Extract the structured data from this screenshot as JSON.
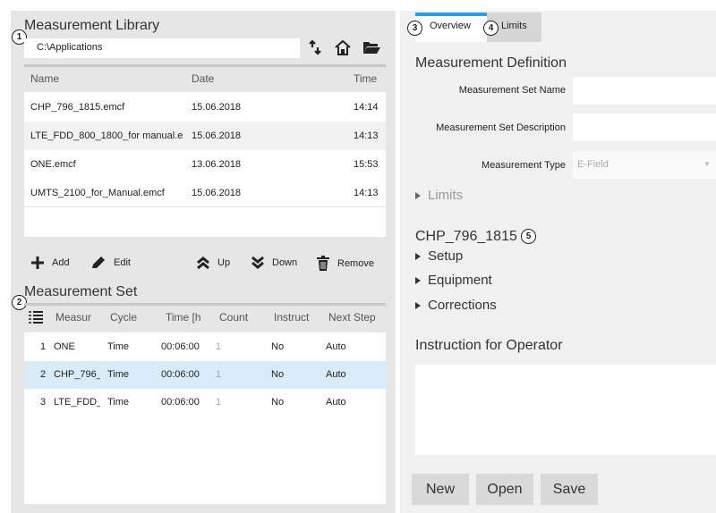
{
  "library": {
    "title": "Measurement Library",
    "path": "C:\\Applications",
    "callout": "1",
    "icons": [
      "refresh-icon",
      "home-icon",
      "folder-open-icon"
    ],
    "columns": [
      "Name",
      "Date",
      "Time"
    ],
    "rows": [
      {
        "name": "CHP_796_1815.emcf",
        "date": "15.06.2018",
        "time": "14:14"
      },
      {
        "name": "LTE_FDD_800_1800_for manual.e",
        "date": "15.06.2018",
        "time": "14:13"
      },
      {
        "name": "ONE.emcf",
        "date": "13.06.2018",
        "time": "15:53"
      },
      {
        "name": "UMTS_2100_for_Manual.emcf",
        "date": "15.06.2018",
        "time": "14:13"
      }
    ]
  },
  "toolbar": {
    "add": "Add",
    "edit": "Edit",
    "up": "Up",
    "down": "Down",
    "remove": "Remove"
  },
  "set": {
    "title": "Measurement Set",
    "callout": "2",
    "columns": [
      "Measur",
      "Cycle",
      "Time [h",
      "Count",
      "Instruct",
      "Next Step"
    ],
    "rows": [
      {
        "no": "1",
        "name": "ONE",
        "cycle": "Time",
        "time": "00:06:00",
        "count": "1",
        "instruct": "No",
        "next": "Auto",
        "selected": false
      },
      {
        "no": "2",
        "name": "CHP_796_",
        "cycle": "Time",
        "time": "00:06:00",
        "count": "1",
        "instruct": "No",
        "next": "Auto",
        "selected": true
      },
      {
        "no": "3",
        "name": "LTE_FDD_8",
        "cycle": "Time",
        "time": "00:06:00",
        "count": "1",
        "instruct": "No",
        "next": "Auto",
        "selected": false
      }
    ]
  },
  "tabs": {
    "overview": "Overview",
    "limits": "Limits",
    "overview_callout": "3",
    "limits_callout": "4"
  },
  "definition": {
    "title": "Measurement Definition",
    "set_name_label": "Measurement Set Name",
    "set_name_value": "",
    "set_desc_label": "Measurement Set Description",
    "set_desc_value": "",
    "type_label": "Measurement Type",
    "type_value": "E-Field",
    "limits_expander": "Limits"
  },
  "selected_measurement": {
    "title": "CHP_796_1815",
    "callout": "5",
    "expanders": [
      "Setup",
      "Equipment",
      "Corrections"
    ]
  },
  "instruction": {
    "title": "Instruction for Operator",
    "value": ""
  },
  "buttons": {
    "new": "New",
    "open": "Open",
    "save": "Save"
  },
  "colors": {
    "selected_row": "#d9ebf9",
    "tab_accent": "#3a9ad9",
    "alt_row": "#f2f2f2"
  }
}
